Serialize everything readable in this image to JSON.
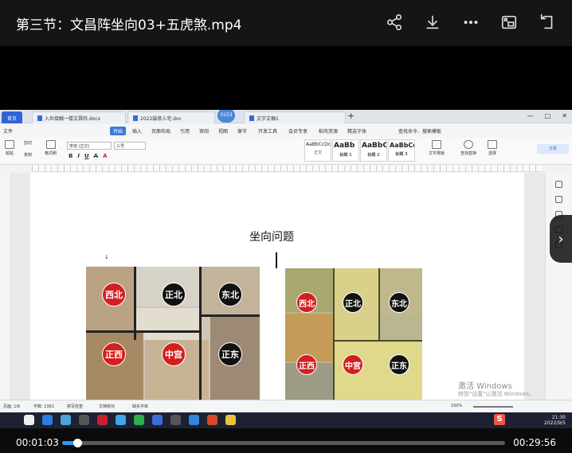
{
  "player": {
    "title": "第三节：文昌阵坐向03+五虎煞.mp4",
    "current_time": "00:01:03",
    "duration": "00:29:56",
    "progress_fraction": 0.035
  },
  "icons": [
    "share-icon",
    "download-icon",
    "more-icon",
    "picture-in-picture-icon",
    "rotate-icon"
  ],
  "app": {
    "tabs": [
      {
        "label": "首页"
      },
      {
        "label": "入伙接触一楼文昌阵.docx"
      },
      {
        "label": "2022装修入宅.doc"
      },
      {
        "label": "文字文稿1"
      }
    ],
    "zoom_bubble": "0153",
    "menus": [
      "文件",
      "开始",
      "插入",
      "页面布局",
      "引用",
      "审阅",
      "视图",
      "章节",
      "开发工具",
      "会员专享",
      "稻壳资源",
      "精选字体",
      "查找命令、搜索模板"
    ],
    "ribbon": {
      "font_name": "宋体 (正文)",
      "font_size": "三号",
      "paste": "粘贴",
      "cut": "剪切",
      "copy": "复制",
      "format_painter": "格式刷",
      "styles": [
        {
          "sample": "AaBbCcDc",
          "name": "正文"
        },
        {
          "sample": "AaBb",
          "name": "标题 1"
        },
        {
          "sample": "AaBbC",
          "name": "标题 2"
        },
        {
          "sample": "AaBbCc",
          "name": "标题 3"
        }
      ],
      "text_layout": "文字排版",
      "find_replace": "查找替换",
      "select": "选择",
      "share": "分享"
    },
    "document": {
      "heading": "坐向问题",
      "left_plan_labels": [
        "西北",
        "正北",
        "东北",
        "正西",
        "中宫",
        "正东"
      ],
      "right_plan_labels": [
        "西北",
        "正北",
        "东北",
        "正西",
        "中宫",
        "正东"
      ]
    },
    "watermark": {
      "line1": "激活 Windows",
      "line2": "转到\"设置\"以激活 Windows。"
    },
    "status": {
      "page": "页面: 1/6",
      "words": "字数: 1361",
      "spell": "拼写检查",
      "doc_check": "文档校对",
      "missing_font": "缺失字体",
      "zoom": "150%"
    },
    "taskbar": {
      "time": "21:30",
      "date": "2022/9/5"
    }
  }
}
